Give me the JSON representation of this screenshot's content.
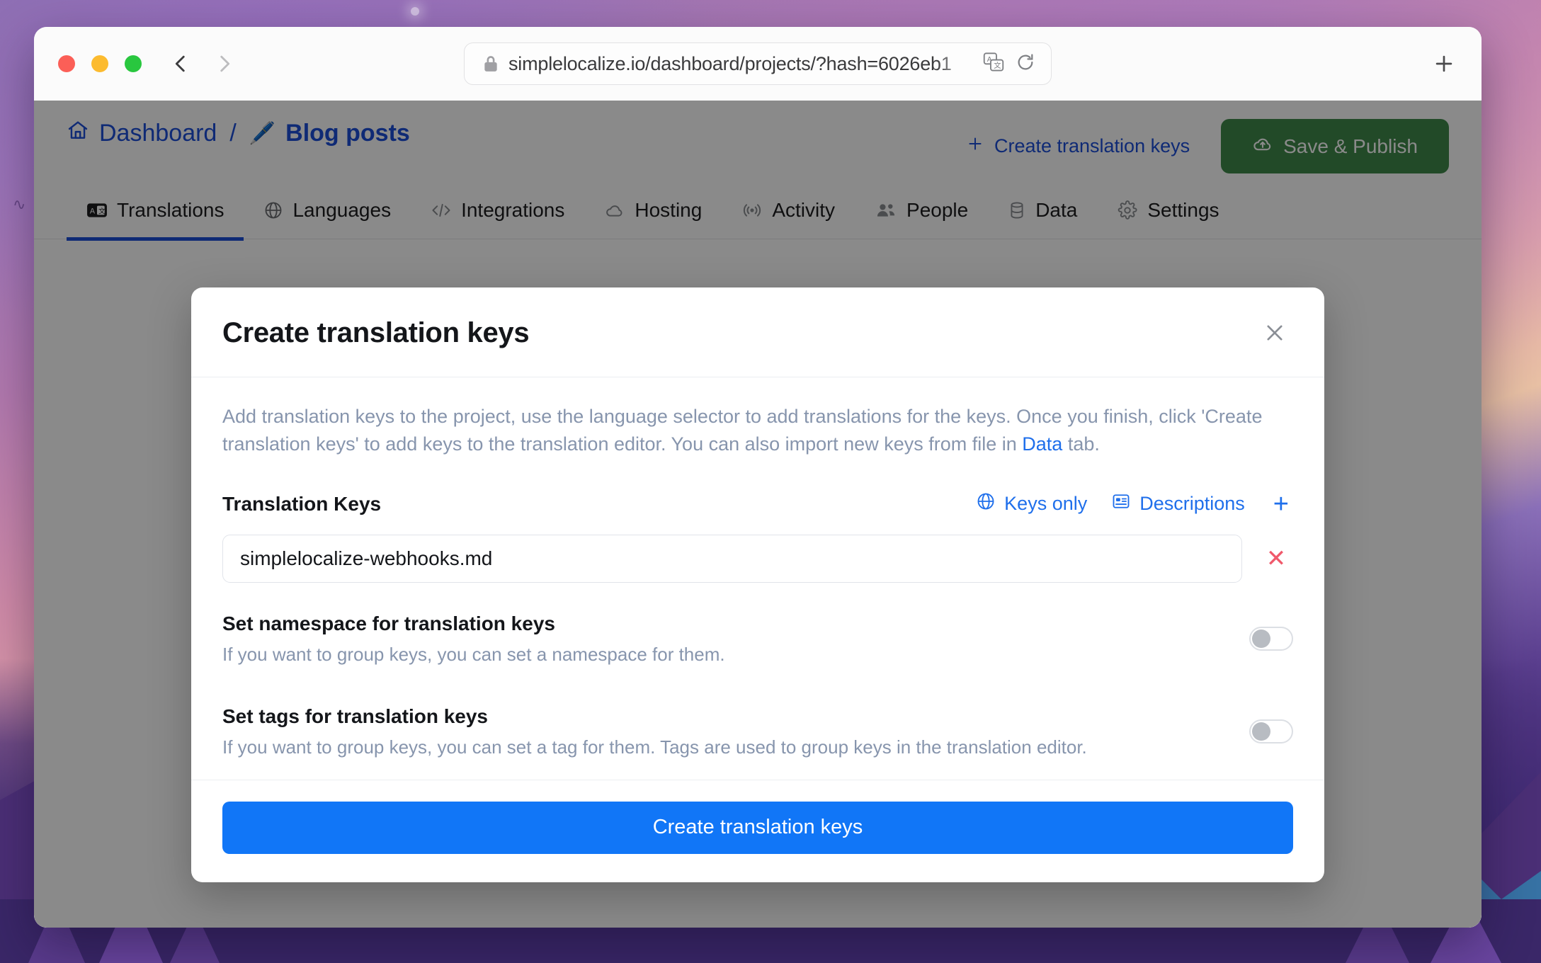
{
  "browser": {
    "url": "simplelocalize.io/dashboard/projects/?hash=6026eb1",
    "lock_icon": "lock-icon",
    "translate_icon": "translate-page-icon",
    "reload_icon": "reload-icon",
    "back_icon": "back-chevron-icon",
    "forward_icon": "forward-chevron-icon",
    "new_tab_label": "+"
  },
  "app": {
    "breadcrumb": {
      "home_icon": "home-icon",
      "dashboard": "Dashboard",
      "separator": "/",
      "project_emoji": "🖊️",
      "project": "Blog posts"
    },
    "header_actions": {
      "create_keys_plus": "+",
      "create_keys_label": "Create translation keys",
      "save_publish_label": "Save & Publish"
    },
    "tabs": [
      {
        "label": "Translations",
        "icon": "translate-badge-icon",
        "active": true
      },
      {
        "label": "Languages",
        "icon": "globe-icon",
        "active": false
      },
      {
        "label": "Integrations",
        "icon": "code-brackets-icon",
        "active": false
      },
      {
        "label": "Hosting",
        "icon": "cloud-icon",
        "active": false
      },
      {
        "label": "Activity",
        "icon": "broadcast-icon",
        "active": false
      },
      {
        "label": "People",
        "icon": "people-icon",
        "active": false
      },
      {
        "label": "Data",
        "icon": "database-icon",
        "active": false
      },
      {
        "label": "Settings",
        "icon": "gear-icon",
        "active": false
      }
    ]
  },
  "modal": {
    "title": "Create translation keys",
    "close_icon": "close-icon",
    "description_part1": "Add translation keys to the project, use the language selector to add translations for the keys. Once you finish, click 'Create translation keys' to add keys to the translation editor. You can also import new keys from file in ",
    "description_link": "Data",
    "description_part2": " tab.",
    "keys_section": {
      "title": "Translation Keys",
      "keys_only_label": "Keys only",
      "keys_only_icon": "globe-icon",
      "descriptions_label": "Descriptions",
      "descriptions_icon": "description-list-icon",
      "add_label": "+",
      "rows": [
        {
          "value": "simplelocalize-webhooks.md",
          "placeholder": "Translation key",
          "remove_label": "✕"
        }
      ]
    },
    "options": [
      {
        "title": "Set namespace for translation keys",
        "description": "If you want to group keys, you can set a namespace for them.",
        "enabled": false
      },
      {
        "title": "Set tags for translation keys",
        "description": "If you want to group keys, you can set a tag for them. Tags are used to group keys in the translation editor.",
        "enabled": false
      }
    ],
    "submit_label": "Create translation keys"
  },
  "colors": {
    "brand_blue": "#1c4ed8",
    "link_blue": "#1f6feb",
    "primary_button": "#1176f7",
    "save_green": "#3f8a4a",
    "danger_red": "#f0596b",
    "muted_text": "#8795ad"
  }
}
